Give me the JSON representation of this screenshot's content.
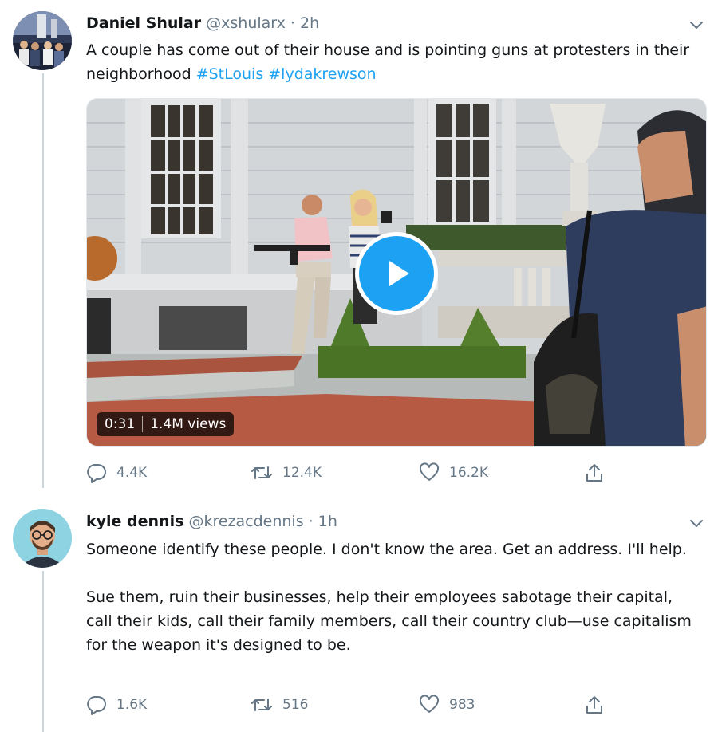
{
  "tweet1": {
    "name": "Daniel Shular",
    "handle": "@xshularx",
    "dot": "·",
    "time": "2h",
    "text": "A couple has come out of their house and is pointing guns at protesters in their neighborhood",
    "hashtag1": "#StLouis",
    "hashtag2": "#lydakrewson",
    "video": {
      "duration": "0:31",
      "views": "1.4M views"
    },
    "counts": {
      "replies": "4.4K",
      "retweets": "12.4K",
      "likes": "16.2K"
    }
  },
  "tweet2": {
    "name": "kyle dennis",
    "handle": "@krezacdennis",
    "dot": "·",
    "time": "1h",
    "paragraph1": "Someone identify these people. I don't know the area. Get an address. I'll help.",
    "paragraph2": "Sue them, ruin their businesses, help their employees sabotage their capital, call their kids, call their family members, call their country club—use capitalism for the weapon it's designed to be.",
    "counts": {
      "replies": "1.6K",
      "retweets": "516",
      "likes": "983"
    }
  },
  "colors": {
    "accent": "#1da1f2",
    "muted": "#657786",
    "text": "#14171a",
    "line": "#ccd6dd"
  },
  "icons": [
    "chevron-down-icon",
    "reply-icon",
    "retweet-icon",
    "like-icon",
    "share-icon",
    "play-icon"
  ]
}
